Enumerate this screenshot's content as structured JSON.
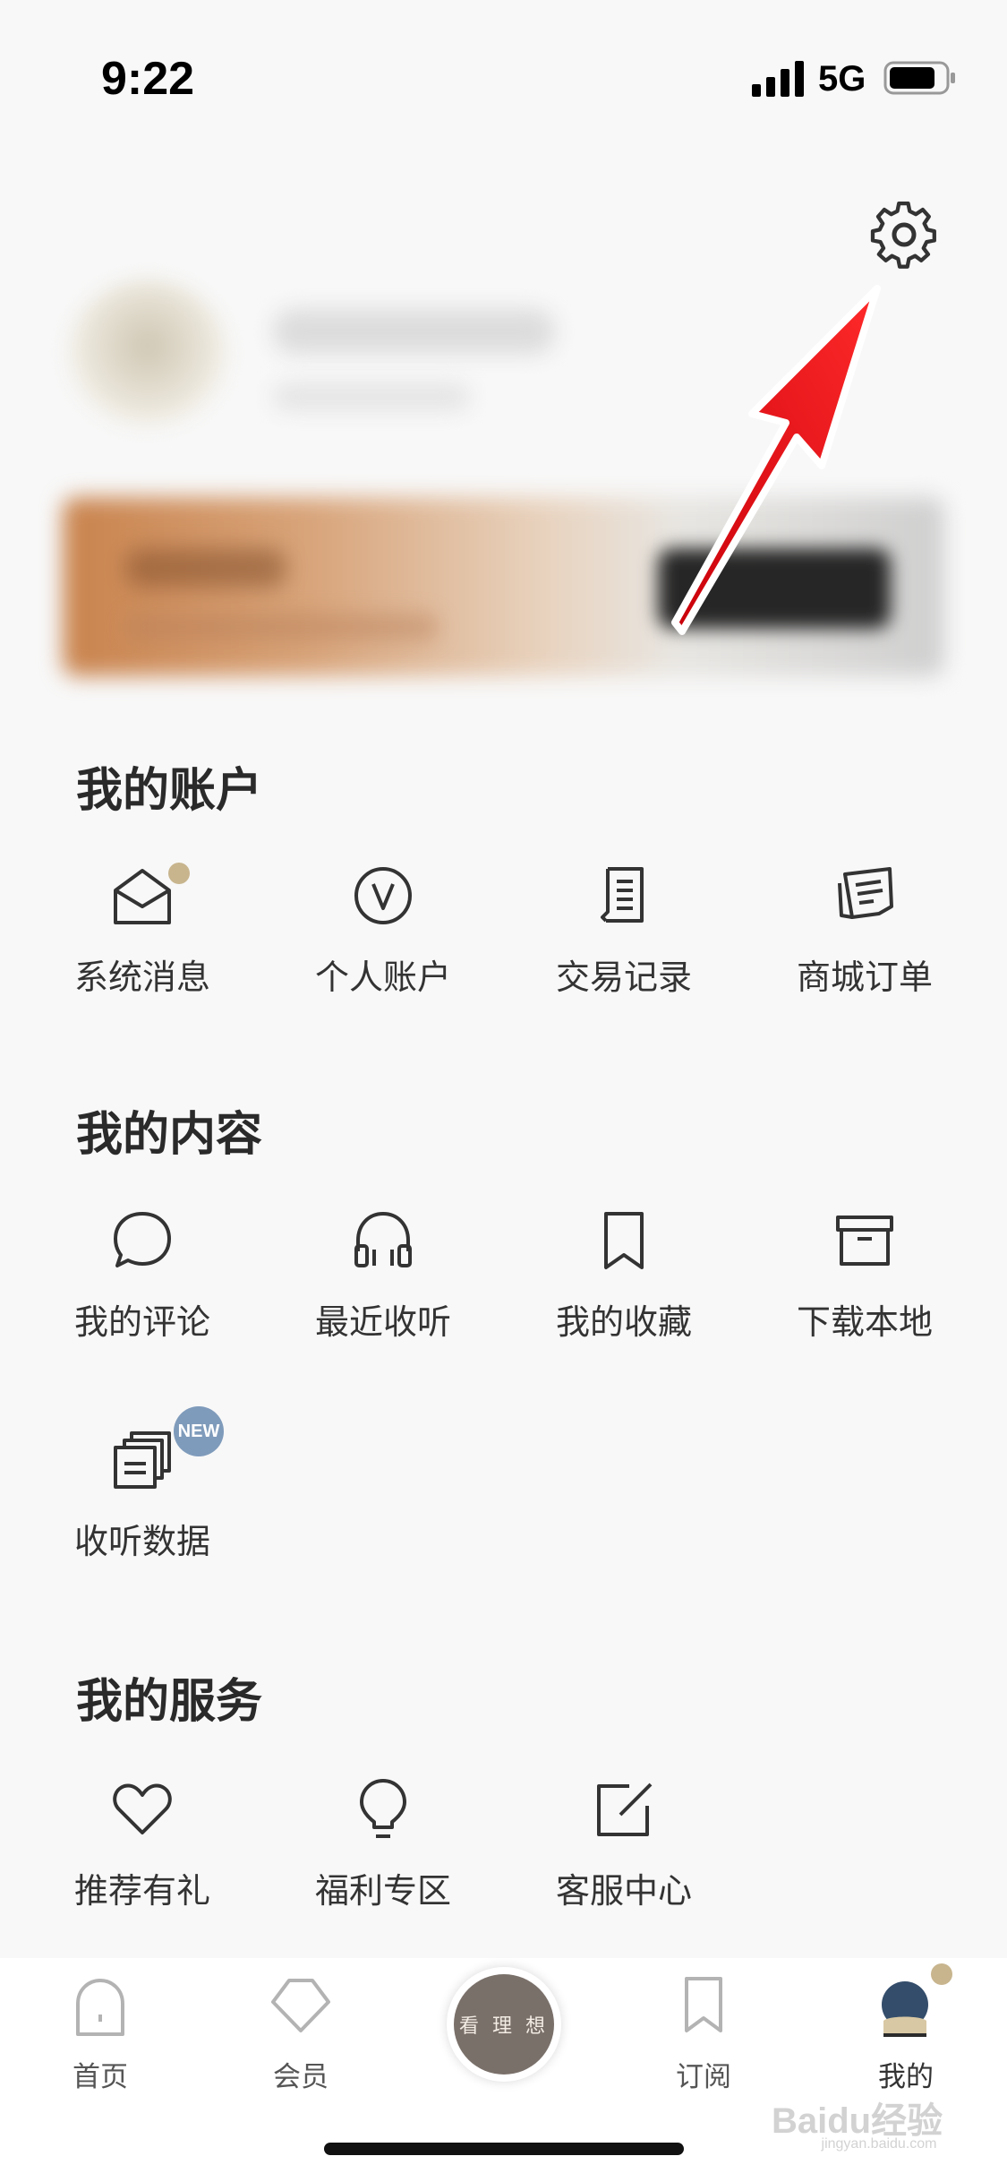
{
  "status_bar": {
    "time": "9:22",
    "network": "5G"
  },
  "header": {
    "settings_icon": "gear-icon"
  },
  "accent_color": "#c8b58e",
  "annotation_arrow_color": "#e8141c",
  "sections": {
    "account": {
      "title": "我的账户",
      "items": [
        {
          "label": "系统消息",
          "icon": "envelope-open-icon",
          "dot": true
        },
        {
          "label": "个人账户",
          "icon": "v-circle-icon"
        },
        {
          "label": "交易记录",
          "icon": "receipt-icon"
        },
        {
          "label": "商城订单",
          "icon": "order-list-icon"
        }
      ]
    },
    "content": {
      "title": "我的内容",
      "items": [
        {
          "label": "我的评论",
          "icon": "comment-bubble-icon"
        },
        {
          "label": "最近收听",
          "icon": "headphones-icon"
        },
        {
          "label": "我的收藏",
          "icon": "bookmark-icon"
        },
        {
          "label": "下载本地",
          "icon": "archive-box-icon"
        },
        {
          "label": "收听数据",
          "icon": "stacked-cards-icon",
          "badge": "NEW"
        }
      ]
    },
    "services": {
      "title": "我的服务",
      "items": [
        {
          "label": "推荐有礼",
          "icon": "heart-icon"
        },
        {
          "label": "福利专区",
          "icon": "lightbulb-icon"
        },
        {
          "label": "客服中心",
          "icon": "edit-square-icon"
        }
      ]
    }
  },
  "tab_bar": {
    "tabs": [
      {
        "label": "首页",
        "icon": "home-arch-icon"
      },
      {
        "label": "会员",
        "icon": "pentagon-icon"
      },
      {
        "label": "看 理 想",
        "icon": "center-circle-icon"
      },
      {
        "label": "订阅",
        "icon": "bookmark-icon"
      },
      {
        "label": "我的",
        "icon": "avatar-icon",
        "active": true
      }
    ]
  },
  "watermark": {
    "brand": "Baidu经验",
    "url": "jingyan.baidu.com"
  }
}
